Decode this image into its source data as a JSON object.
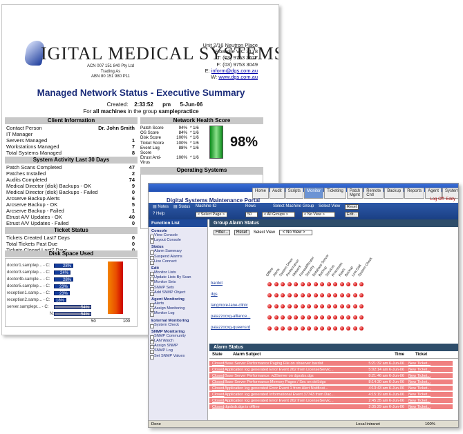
{
  "company": {
    "name": "IGITAL MEDICAL SYSTEMS",
    "acn": "ACN 007 151 840 Pty Ltd",
    "trading": "Trading As",
    "abn": "ABN 80 151 980 P11",
    "address": [
      "Unit 2/16 Neutron Place",
      "Rowville VIC 3178",
      "T: (03) 9753 3677",
      "F: (03) 9753 3049"
    ],
    "email_label": "E:",
    "email": "inform@dgs.com.au",
    "web_label": "W:",
    "web": "www.dgs.com.au"
  },
  "report": {
    "title": "Managed Network Status - Executive Summary",
    "created_label": "Created:",
    "time": "2:33:52",
    "ampm": "pm",
    "date": "5-Jun-06",
    "group_prefix": "For",
    "all_machines": "all machines",
    "group_mid": "in the group",
    "group_name": "samplepractice"
  },
  "client_info": {
    "header": "Client Information",
    "rows": [
      {
        "label": "Contact Person",
        "value": "Dr. John Smith"
      },
      {
        "label": "IT Manager",
        "value": ""
      },
      {
        "label": "Servers Managed",
        "value": "1"
      },
      {
        "label": "Workstations Managed",
        "value": "7"
      },
      {
        "label": "Total Systems Managed",
        "value": "8"
      }
    ]
  },
  "activity": {
    "header": "System Activity Last 30 Days",
    "rows": [
      {
        "label": "Patch Scans Completed",
        "value": "47"
      },
      {
        "label": "Patches Installed",
        "value": "2"
      },
      {
        "label": "Audits Completed",
        "value": "74"
      },
      {
        "label": "Medical Director (disk) Backups - OK",
        "value": "9"
      },
      {
        "label": "Medical Director (disk) Backups - Failed",
        "value": "0"
      },
      {
        "label": "Arcserve Backup Alerts",
        "value": "6"
      },
      {
        "label": "Arcserve Backup - OK",
        "value": "5"
      },
      {
        "label": "Arcserve Backup - Failed",
        "value": "1"
      },
      {
        "label": "Etrust A/V Updates - OK",
        "value": "40"
      },
      {
        "label": "Etrust A/V Updates - Failed",
        "value": "0"
      }
    ]
  },
  "tickets": {
    "header": "Ticket Status",
    "rows": [
      {
        "label": "Tickets Created Last7 Days",
        "value": "0"
      },
      {
        "label": "Total Tickets Past Due",
        "value": "0"
      },
      {
        "label": "Tickets Closed Last7 Days",
        "value": "0"
      }
    ]
  },
  "disk": {
    "header": "Disk Space Used",
    "rows": [
      {
        "label": "doctor1.samplep... - C:",
        "pct": "28%",
        "value": 28
      },
      {
        "label": "doctor3.samplep... - C:",
        "pct": "24%",
        "value": 24
      },
      {
        "label": "doctor4b.sample... - C:",
        "pct": "28%",
        "value": 28
      },
      {
        "label": "doctor5.samplep... - C:",
        "pct": "23%",
        "value": 23
      },
      {
        "label": "reception1.samp... - C:",
        "pct": "23%",
        "value": 23
      },
      {
        "label": "reception2.samp... - C:",
        "pct": "18%",
        "value": 18
      },
      {
        "label": "server.samplepr... - C:",
        "pct": "54%",
        "value": 54
      },
      {
        "label": "N:",
        "pct": "54%",
        "value": 54
      }
    ],
    "axis": [
      "50",
      "100"
    ]
  },
  "health": {
    "header": "Network Health Score",
    "rows": [
      {
        "label": "Patch Score",
        "pct": "94%",
        "w": "* 1/6"
      },
      {
        "label": "OS Score",
        "pct": "84%",
        "w": "* 1/6"
      },
      {
        "label": "Disk Score",
        "pct": "100%",
        "w": "* 1/6"
      },
      {
        "label": "Ticket Score",
        "pct": "100%",
        "w": "* 1/6"
      },
      {
        "label": "Event Log Score",
        "pct": "88%",
        "w": "* 1/6"
      },
      {
        "label": "Etrust Anti-Virus",
        "pct": "100%",
        "w": "* 1/6"
      }
    ],
    "total": "98%",
    "total_value": 98
  },
  "os": {
    "header": "Operating Systems"
  },
  "portal": {
    "title": "Digital Systems Maintenance Portal",
    "logoff": "Log Off: Eddy",
    "nav": [
      "Home",
      "Audit",
      "Scripts",
      "Monitor",
      "Ticketing",
      "Patch Mgmt",
      "Remote Cntl",
      "Backup",
      "Reports",
      "Agent",
      "System"
    ],
    "nav_active": "Monitor",
    "notes": "Notes",
    "status": "Status",
    "help": "Help",
    "machine_id": "Machine ID",
    "rows_label": "Rows",
    "select_group_label": "Select Machine Group",
    "select_view_label": "Select View",
    "reset": "Reset",
    "edit": "Edit...",
    "select_page": "< Select Page >",
    "rows_value": "50",
    "all_groups": "< All Groups >",
    "no_view": "< No View >"
  },
  "function_list": {
    "header": "Function List",
    "groups": [
      {
        "name": "Console",
        "items": [
          "View Console",
          "Layout Console"
        ]
      },
      {
        "name": "Status",
        "items": [
          "Alarm Summary",
          "Suspend Alarms",
          "Live Connect"
        ]
      },
      {
        "name": "Edit",
        "items": [
          "Monitor Lists",
          "Update Lists By Scan",
          "Monitor Sets",
          "SNMP Sets",
          "Add SNMP Object"
        ]
      },
      {
        "name": "Agent Monitoring",
        "items": [
          "Alerts",
          "Assign Monitoring",
          "Monitor Log"
        ]
      },
      {
        "name": "External Monitoring",
        "items": [
          "System Check"
        ]
      },
      {
        "name": "SNMP Monitoring",
        "items": [
          "SNMP Community",
          "LAN Watch",
          "Assign SNMP",
          "SNMP Log",
          "Set SNMP Values"
        ]
      }
    ]
  },
  "group_alarm": {
    "header": "Group Alarm Status",
    "filter": "Filter...",
    "reset": "Reset",
    "select_view": "Select View",
    "view_value": "< No View >",
    "columns": [
      "Offline",
      "Alerts",
      "System Down",
      "Performance",
      "Network",
      "Firewall/Router",
      "Security",
      "Database Server",
      "Backup",
      "Services",
      "Processes",
      "Patch",
      "Backup",
      "Low Disk",
      "System Check"
    ],
    "rows": [
      {
        "name": "bardot",
        "dots": [
          "r",
          "r",
          "r",
          "r",
          "r",
          "r",
          "r",
          "r",
          "r",
          "r",
          "r",
          "r",
          "r",
          "r",
          "r"
        ]
      },
      {
        "name": "dgs",
        "dots": [
          "r",
          "r",
          "r",
          "r",
          "r",
          "r",
          "r",
          "r",
          "r",
          "r",
          "r",
          "r",
          "r",
          "r",
          "r"
        ]
      },
      {
        "name": "langmore-lane-clinic",
        "dots": [
          "r",
          "r",
          "r",
          "r",
          "r",
          "r",
          "r",
          "r",
          "r",
          "r",
          "r",
          "r",
          "r",
          "r",
          "r"
        ]
      },
      {
        "name": "palazzocxg-alliance...",
        "dots": [
          "r",
          "r",
          "r",
          "r",
          "r",
          "r",
          "r",
          "r",
          "r",
          "r",
          "r",
          "r",
          "r",
          "r",
          "r"
        ]
      },
      {
        "name": "palazzocxg-queensrd",
        "dots": [
          "r",
          "r",
          "r",
          "r",
          "r",
          "r",
          "r",
          "r",
          "r",
          "r",
          "r",
          "r",
          "r",
          "r",
          "r"
        ]
      }
    ]
  },
  "alarm_status": {
    "header": "Alarm Status",
    "columns": [
      "State",
      "Alarm Subject",
      "Time",
      "Ticket"
    ],
    "rows": [
      {
        "state": "Closed",
        "subject": "Base Server Performance:Paging File on observer bardot",
        "time": "5:21:32 am 6-Jun-06",
        "ticket": "New Ticket..."
      },
      {
        "state": "Closed",
        "subject": "Application log generated Error Event 262 from LicenseServic...",
        "time": "5:02:14 am 6-Jun-06",
        "ticket": "New Ticket..."
      },
      {
        "state": "Closed",
        "subject": "Base Server Performance: w3Server on dgssbs.dgs",
        "time": "8:21:46 am 6-Jun-06",
        "ticket": "New Ticket..."
      },
      {
        "state": "Closed",
        "subject": "Base Server Performance:Memory Pages / Sec on dell.dgs",
        "time": "8:14:30 am 6-Jun-06",
        "ticket": "New Ticket..."
      },
      {
        "state": "Closed",
        "subject": "Application log generated Error Event 1 from Alert Notificat...",
        "time": "4:13:43 am 6-Jun-06",
        "ticket": "New Ticket..."
      },
      {
        "state": "Closed",
        "subject": "Application log generated Informational Event 37743 from Dac...",
        "time": "4:15:19 am 6-Jun-06",
        "ticket": "New Ticket..."
      },
      {
        "state": "Closed",
        "subject": "Application log generated Error Event 262 from LicenseServic...",
        "time": "2:45:35 am 6-Jun-06",
        "ticket": "New Ticket..."
      },
      {
        "state": "Closed",
        "subject": "dgsbsb.dgs is offline",
        "time": "2:35:29 am 6-Jun-06",
        "ticket": "New Ticket..."
      }
    ]
  },
  "statusbar": {
    "left": "Done",
    "mid": "Local intranet",
    "right": "100%"
  }
}
